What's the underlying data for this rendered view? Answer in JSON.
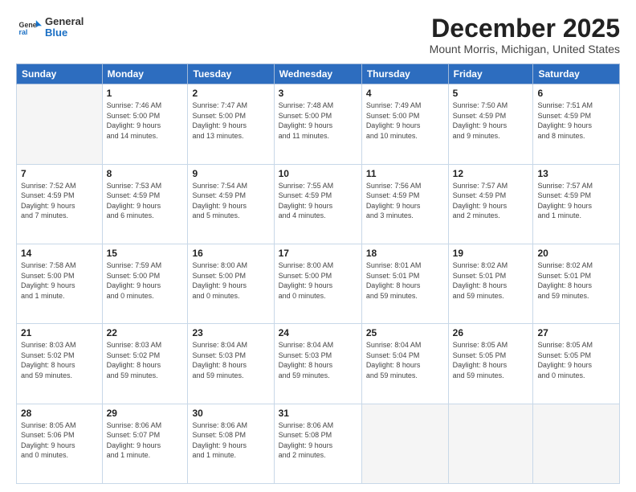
{
  "logo": {
    "general": "General",
    "blue": "Blue"
  },
  "header": {
    "month": "December 2025",
    "location": "Mount Morris, Michigan, United States"
  },
  "weekdays": [
    "Sunday",
    "Monday",
    "Tuesday",
    "Wednesday",
    "Thursday",
    "Friday",
    "Saturday"
  ],
  "weeks": [
    [
      {
        "day": "",
        "info": ""
      },
      {
        "day": "1",
        "info": "Sunrise: 7:46 AM\nSunset: 5:00 PM\nDaylight: 9 hours\nand 14 minutes."
      },
      {
        "day": "2",
        "info": "Sunrise: 7:47 AM\nSunset: 5:00 PM\nDaylight: 9 hours\nand 13 minutes."
      },
      {
        "day": "3",
        "info": "Sunrise: 7:48 AM\nSunset: 5:00 PM\nDaylight: 9 hours\nand 11 minutes."
      },
      {
        "day": "4",
        "info": "Sunrise: 7:49 AM\nSunset: 5:00 PM\nDaylight: 9 hours\nand 10 minutes."
      },
      {
        "day": "5",
        "info": "Sunrise: 7:50 AM\nSunset: 4:59 PM\nDaylight: 9 hours\nand 9 minutes."
      },
      {
        "day": "6",
        "info": "Sunrise: 7:51 AM\nSunset: 4:59 PM\nDaylight: 9 hours\nand 8 minutes."
      }
    ],
    [
      {
        "day": "7",
        "info": "Sunrise: 7:52 AM\nSunset: 4:59 PM\nDaylight: 9 hours\nand 7 minutes."
      },
      {
        "day": "8",
        "info": "Sunrise: 7:53 AM\nSunset: 4:59 PM\nDaylight: 9 hours\nand 6 minutes."
      },
      {
        "day": "9",
        "info": "Sunrise: 7:54 AM\nSunset: 4:59 PM\nDaylight: 9 hours\nand 5 minutes."
      },
      {
        "day": "10",
        "info": "Sunrise: 7:55 AM\nSunset: 4:59 PM\nDaylight: 9 hours\nand 4 minutes."
      },
      {
        "day": "11",
        "info": "Sunrise: 7:56 AM\nSunset: 4:59 PM\nDaylight: 9 hours\nand 3 minutes."
      },
      {
        "day": "12",
        "info": "Sunrise: 7:57 AM\nSunset: 4:59 PM\nDaylight: 9 hours\nand 2 minutes."
      },
      {
        "day": "13",
        "info": "Sunrise: 7:57 AM\nSunset: 4:59 PM\nDaylight: 9 hours\nand 1 minute."
      }
    ],
    [
      {
        "day": "14",
        "info": "Sunrise: 7:58 AM\nSunset: 5:00 PM\nDaylight: 9 hours\nand 1 minute."
      },
      {
        "day": "15",
        "info": "Sunrise: 7:59 AM\nSunset: 5:00 PM\nDaylight: 9 hours\nand 0 minutes."
      },
      {
        "day": "16",
        "info": "Sunrise: 8:00 AM\nSunset: 5:00 PM\nDaylight: 9 hours\nand 0 minutes."
      },
      {
        "day": "17",
        "info": "Sunrise: 8:00 AM\nSunset: 5:00 PM\nDaylight: 9 hours\nand 0 minutes."
      },
      {
        "day": "18",
        "info": "Sunrise: 8:01 AM\nSunset: 5:01 PM\nDaylight: 8 hours\nand 59 minutes."
      },
      {
        "day": "19",
        "info": "Sunrise: 8:02 AM\nSunset: 5:01 PM\nDaylight: 8 hours\nand 59 minutes."
      },
      {
        "day": "20",
        "info": "Sunrise: 8:02 AM\nSunset: 5:01 PM\nDaylight: 8 hours\nand 59 minutes."
      }
    ],
    [
      {
        "day": "21",
        "info": "Sunrise: 8:03 AM\nSunset: 5:02 PM\nDaylight: 8 hours\nand 59 minutes."
      },
      {
        "day": "22",
        "info": "Sunrise: 8:03 AM\nSunset: 5:02 PM\nDaylight: 8 hours\nand 59 minutes."
      },
      {
        "day": "23",
        "info": "Sunrise: 8:04 AM\nSunset: 5:03 PM\nDaylight: 8 hours\nand 59 minutes."
      },
      {
        "day": "24",
        "info": "Sunrise: 8:04 AM\nSunset: 5:03 PM\nDaylight: 8 hours\nand 59 minutes."
      },
      {
        "day": "25",
        "info": "Sunrise: 8:04 AM\nSunset: 5:04 PM\nDaylight: 8 hours\nand 59 minutes."
      },
      {
        "day": "26",
        "info": "Sunrise: 8:05 AM\nSunset: 5:05 PM\nDaylight: 8 hours\nand 59 minutes."
      },
      {
        "day": "27",
        "info": "Sunrise: 8:05 AM\nSunset: 5:05 PM\nDaylight: 9 hours\nand 0 minutes."
      }
    ],
    [
      {
        "day": "28",
        "info": "Sunrise: 8:05 AM\nSunset: 5:06 PM\nDaylight: 9 hours\nand 0 minutes."
      },
      {
        "day": "29",
        "info": "Sunrise: 8:06 AM\nSunset: 5:07 PM\nDaylight: 9 hours\nand 1 minute."
      },
      {
        "day": "30",
        "info": "Sunrise: 8:06 AM\nSunset: 5:08 PM\nDaylight: 9 hours\nand 1 minute."
      },
      {
        "day": "31",
        "info": "Sunrise: 8:06 AM\nSunset: 5:08 PM\nDaylight: 9 hours\nand 2 minutes."
      },
      {
        "day": "",
        "info": ""
      },
      {
        "day": "",
        "info": ""
      },
      {
        "day": "",
        "info": ""
      }
    ]
  ]
}
